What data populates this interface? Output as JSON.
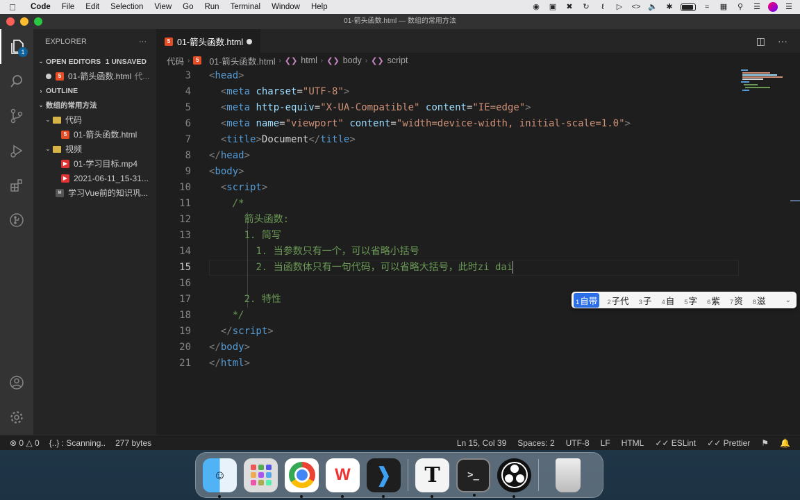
{
  "menubar": {
    "app": "Code",
    "items": [
      "File",
      "Edit",
      "Selection",
      "View",
      "Go",
      "Run",
      "Terminal",
      "Window",
      "Help"
    ]
  },
  "window": {
    "title": "01-箭头函数.html — 数组的常用方法"
  },
  "activity": {
    "explorer_badge": "1"
  },
  "sidebar": {
    "header": "EXPLORER",
    "open_editors": {
      "label": "OPEN EDITORS",
      "badge": "1 UNSAVED",
      "file": "01-箭头函数.html",
      "path": "代..."
    },
    "outline": "OUTLINE",
    "root": "数组的常用方法",
    "tree": [
      {
        "label": "代码",
        "kind": "folder"
      },
      {
        "label": "01-箭头函数.html",
        "kind": "html"
      },
      {
        "label": "视频",
        "kind": "folder"
      },
      {
        "label": "01-学习目标.mp4",
        "kind": "video"
      },
      {
        "label": "2021-06-11_15-31...",
        "kind": "video"
      },
      {
        "label": "学习Vue前的知识巩...",
        "kind": "md"
      }
    ]
  },
  "tab": {
    "label": "01-箭头函数.html"
  },
  "breadcrumb": [
    "代码",
    "01-箭头函数.html",
    "html",
    "body",
    "script"
  ],
  "code": {
    "lines": [
      {
        "n": "3",
        "html": "<span class='tg'>&lt;</span><span class='tn'>head</span><span class='tg'>&gt;</span>",
        "indent": 0
      },
      {
        "n": "4",
        "indent": 1
      },
      {
        "n": "5",
        "indent": 1
      },
      {
        "n": "6",
        "indent": 1
      },
      {
        "n": "7",
        "indent": 1
      },
      {
        "n": "8",
        "indent": 0
      },
      {
        "n": "9",
        "indent": 0
      },
      {
        "n": "10",
        "indent": 1
      },
      {
        "n": "11",
        "indent": 2
      },
      {
        "n": "12",
        "indent": 3
      },
      {
        "n": "13",
        "indent": 3
      },
      {
        "n": "14",
        "indent": 4
      },
      {
        "n": "15",
        "indent": 4
      },
      {
        "n": "16",
        "indent": 0
      },
      {
        "n": "17",
        "indent": 3
      },
      {
        "n": "18",
        "indent": 2
      },
      {
        "n": "19",
        "indent": 1
      },
      {
        "n": "20",
        "indent": 0
      },
      {
        "n": "21",
        "indent": 0
      }
    ],
    "tokens": {
      "head": "head",
      "meta": "meta",
      "charset_attr": "charset",
      "charset_val": "\"UTF-8\"",
      "http_equiv": "http-equiv",
      "http_equiv_val": "\"X-UA-Compatible\"",
      "content": "content",
      "content_val1": "\"IE=edge\"",
      "name": "name",
      "name_val": "\"viewport\"",
      "content_val2": "\"width=device-width, initial-scale=1.0\"",
      "title": "title",
      "title_text": "Document",
      "body": "body",
      "script": "script",
      "html": "html",
      "cm_open": "/*",
      "cm_close": "*/",
      "cm_l12": "箭头函数:",
      "cm_l13": "1. 简写",
      "cm_l14": "1. 当参数只有一个，可以省略小括号",
      "cm_l15": "2. 当函数体只有一句代码，可以省略大括号，此时zi dai",
      "cm_l17": "2. 特性"
    }
  },
  "ime": {
    "candidates": [
      {
        "n": "1",
        "text": "自带"
      },
      {
        "n": "2",
        "text": "子代"
      },
      {
        "n": "3",
        "text": "子"
      },
      {
        "n": "4",
        "text": "自"
      },
      {
        "n": "5",
        "text": "字"
      },
      {
        "n": "6",
        "text": "紫"
      },
      {
        "n": "7",
        "text": "资"
      },
      {
        "n": "8",
        "text": "滋"
      }
    ]
  },
  "status": {
    "errors": "0",
    "warnings": "0",
    "scanning": "{..} : Scanning..",
    "size": "277 bytes",
    "position": "Ln 15, Col 39",
    "spaces": "Spaces: 2",
    "encoding": "UTF-8",
    "eol": "LF",
    "language": "HTML",
    "eslint": "ESLint",
    "prettier": "Prettier"
  },
  "dock": {
    "typora_glyph": "T",
    "terminal_glyph": ">_"
  }
}
